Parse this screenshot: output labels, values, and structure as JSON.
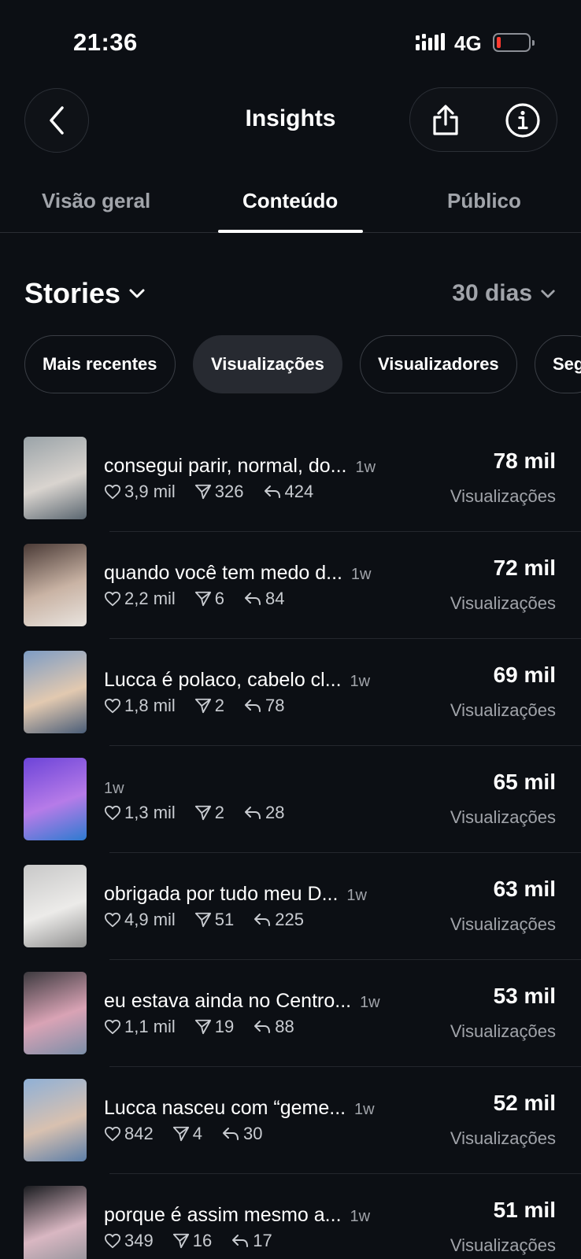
{
  "status_bar": {
    "time": "21:36",
    "network": "4G",
    "battery_level": 0.12,
    "battery_color": "#ff3b30"
  },
  "header": {
    "title": "Insights"
  },
  "tabs": [
    {
      "label": "Visão geral",
      "active": false
    },
    {
      "label": "Conteúdo",
      "active": true
    },
    {
      "label": "Público",
      "active": false
    }
  ],
  "section": {
    "title": "Stories",
    "period": "30 dias"
  },
  "filters": [
    {
      "label": "Mais recentes",
      "selected": false
    },
    {
      "label": "Visualizações",
      "selected": true
    },
    {
      "label": "Visualizadores",
      "selected": false
    },
    {
      "label": "Seg",
      "selected": false
    }
  ],
  "stories": [
    {
      "caption": "consegui parir, normal, do...",
      "age": "1w",
      "likes": "3,9 mil",
      "shares": "326",
      "replies": "424",
      "views": "78 mil",
      "views_label": "Visualizações",
      "thumb_colors": [
        "#9aa3a8",
        "#d9d4cf",
        "#5a6670"
      ]
    },
    {
      "caption": "quando você tem medo d...",
      "age": "1w",
      "likes": "2,2 mil",
      "shares": "6",
      "replies": "84",
      "views": "72 mil",
      "views_label": "Visualizações",
      "thumb_colors": [
        "#4a3a36",
        "#c9b3a4",
        "#e9e4df"
      ]
    },
    {
      "caption": "Lucca é polaco, cabelo cl...",
      "age": "1w",
      "likes": "1,8 mil",
      "shares": "2",
      "replies": "78",
      "views": "69 mil",
      "views_label": "Visualizações",
      "thumb_colors": [
        "#7d9cc4",
        "#e2c9b0",
        "#4a5d78"
      ]
    },
    {
      "caption": "",
      "age": "1w",
      "likes": "1,3 mil",
      "shares": "2",
      "replies": "28",
      "views": "65 mil",
      "views_label": "Visualizações",
      "thumb_colors": [
        "#6c44d8",
        "#b67be8",
        "#2d7bd0"
      ]
    },
    {
      "caption": "obrigada por tudo meu D...",
      "age": "1w",
      "likes": "4,9 mil",
      "shares": "51",
      "replies": "225",
      "views": "63 mil",
      "views_label": "Visualizações",
      "thumb_colors": [
        "#c8c8c8",
        "#ecebe9",
        "#8f8f8f"
      ]
    },
    {
      "caption": "eu estava ainda no Centro...",
      "age": "1w",
      "likes": "1,1 mil",
      "shares": "19",
      "replies": "88",
      "views": "53 mil",
      "views_label": "Visualizações",
      "thumb_colors": [
        "#3d3a3f",
        "#d9a3b5",
        "#7b8ea8"
      ]
    },
    {
      "caption": "Lucca nasceu com “geme...",
      "age": "1w",
      "likes": "842",
      "shares": "4",
      "replies": "30",
      "views": "52 mil",
      "views_label": "Visualizações",
      "thumb_colors": [
        "#8fb0d6",
        "#d8c1b0",
        "#5c7ea8"
      ]
    },
    {
      "caption": "porque é assim mesmo a...",
      "age": "1w",
      "likes": "349",
      "shares": "16",
      "replies": "17",
      "views": "51 mil",
      "views_label": "Visualizações",
      "thumb_colors": [
        "#1a1c20",
        "#d9b7c2",
        "#8c8f96"
      ]
    }
  ]
}
